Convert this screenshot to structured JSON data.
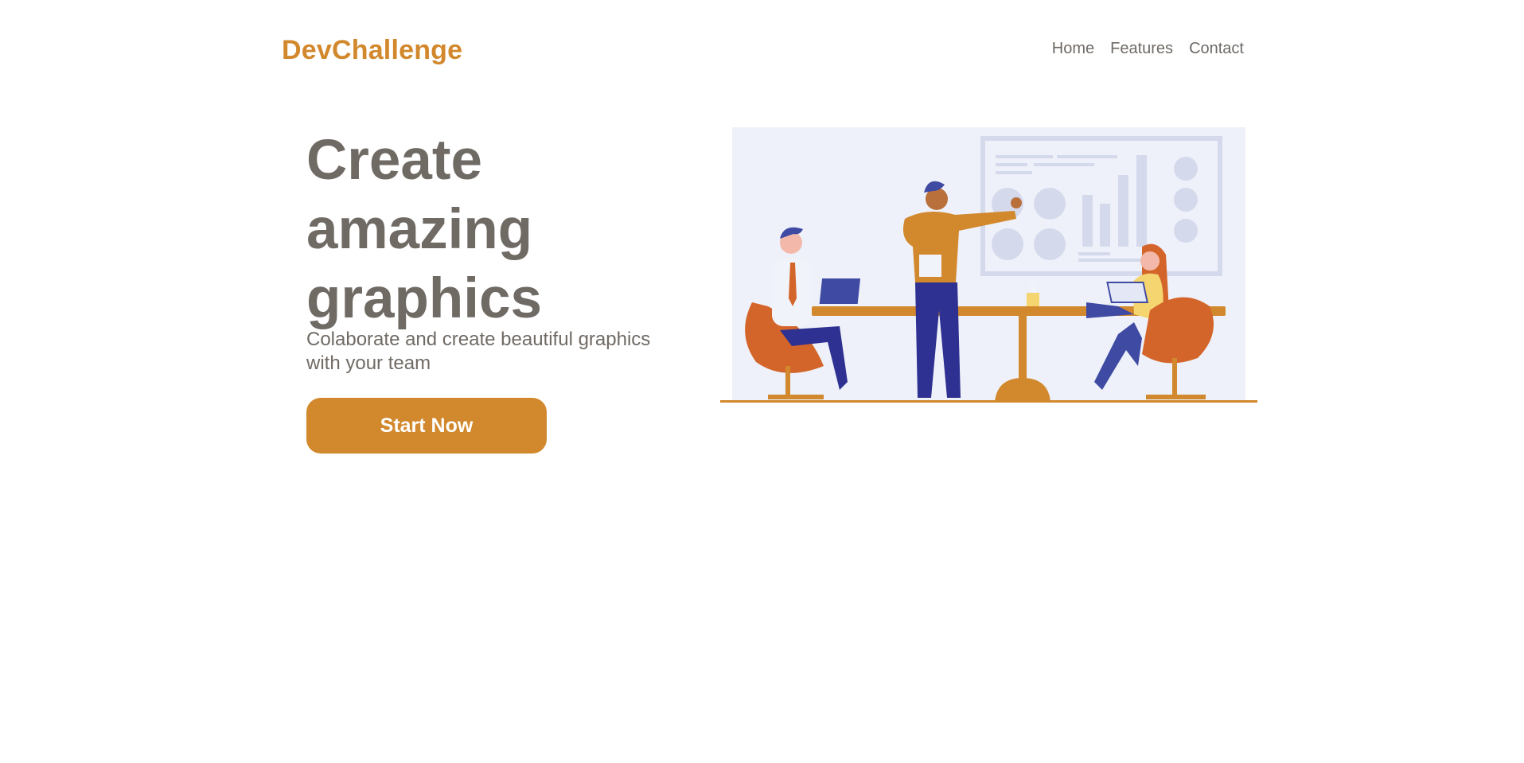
{
  "header": {
    "brand": "DevChallenge",
    "nav": {
      "home": "Home",
      "features": "Features",
      "contact": "Contact"
    }
  },
  "hero": {
    "title": "Create amazing graphics",
    "subtitle": "Colaborate and create beautiful graphics with your team",
    "cta_label": "Start Now"
  },
  "colors": {
    "accent": "#D2882C",
    "text": "#706A64",
    "background": "#FFFFFF",
    "illustration_bg": "#EEF1F9"
  },
  "illustration": {
    "icon": "team-meeting-illustration"
  }
}
